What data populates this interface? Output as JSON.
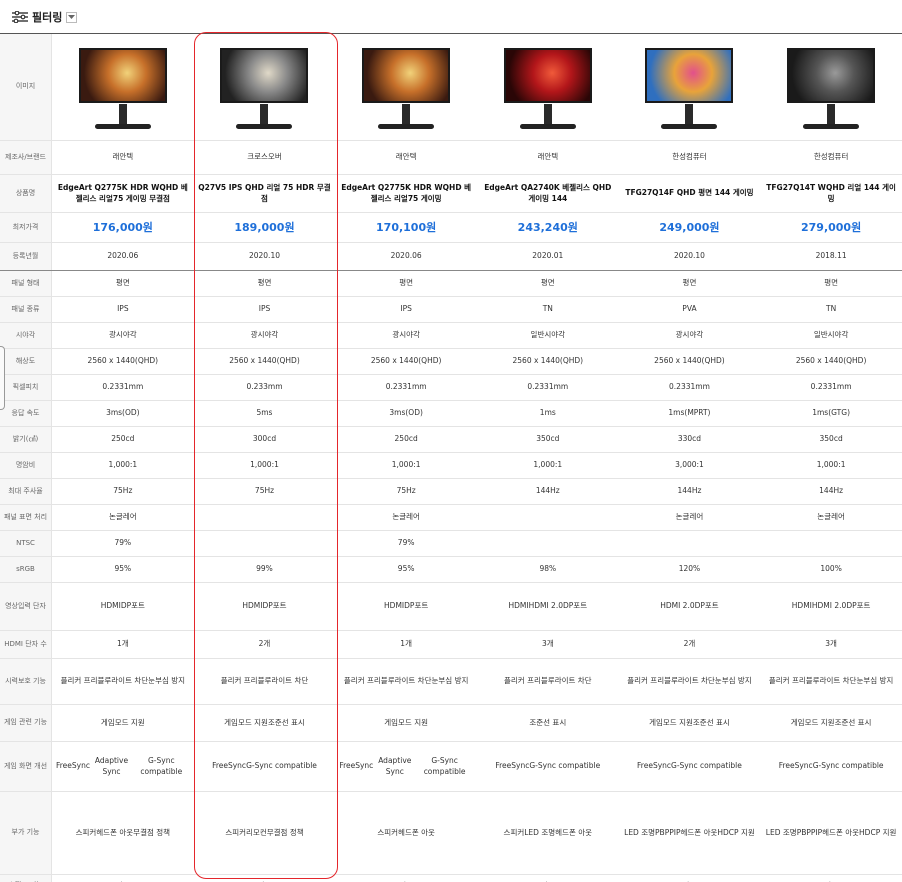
{
  "filter": {
    "label": "필터링"
  },
  "labels": {
    "image": "이미지",
    "maker": "제조사/브랜드",
    "name": "상품명",
    "price": "최저가격",
    "date": "등록년월",
    "panel_type": "패널 형태",
    "panel_kind": "패널 종류",
    "viewing_angle": "시야각",
    "resolution": "해상도",
    "pixel_pitch": "픽셀피치",
    "response": "응답 속도",
    "brightness": "밝기(㎠)",
    "contrast": "명암비",
    "refresh": "최대 주사율",
    "surface": "패널 표면 처리",
    "ntsc": "NTSC",
    "srgb": "sRGB",
    "inputs": "영상입력 단자",
    "hdmi_count": "HDMI 단자 수",
    "eye_care": "시력보호 기능",
    "gaming": "게임 관련 기능",
    "game_screen": "게임 화면 개선",
    "extra": "부가 기능",
    "stand": "스탠드 기능"
  },
  "products": [
    {
      "maker": "래안텍",
      "name": "EdgeArt Q2775K HDR WQHD 베젤리스 리얼75 게이밍 무결점",
      "price": "176,000원",
      "date": "2020.06",
      "panel_type": "평면",
      "panel_kind": "IPS",
      "viewing_angle": "광시야각",
      "resolution": "2560 x 1440(QHD)",
      "pixel_pitch": "0.2331mm",
      "response": "3ms(OD)",
      "brightness": "250cd",
      "contrast": "1,000:1",
      "refresh": "75Hz",
      "surface": "논글레어",
      "ntsc": "79%",
      "srgb": "95%",
      "inputs": [
        "HDMI",
        "DP포트"
      ],
      "hdmi_count": "1개",
      "eye_care": [
        "플리커 프리",
        "블루라이트 차단",
        "눈부심 방지"
      ],
      "gaming": [
        "게임모드 지원"
      ],
      "game_screen": [
        "FreeSync",
        "Adaptive Sync",
        "G-Sync compatible"
      ],
      "extra": [
        "스피커",
        "헤드폰 아웃",
        "무결점 정책"
      ],
      "stand": "틸트",
      "screen_colors": [
        "#3a1a10",
        "#c7702a",
        "#f1d27a"
      ]
    },
    {
      "maker": "크로스오버",
      "name": "Q27V5 IPS QHD 리얼 75 HDR 무결점",
      "price": "189,000원",
      "date": "2020.10",
      "panel_type": "평면",
      "panel_kind": "IPS",
      "viewing_angle": "광시야각",
      "resolution": "2560 x 1440(QHD)",
      "pixel_pitch": "0.233mm",
      "response": "5ms",
      "brightness": "300cd",
      "contrast": "1,000:1",
      "refresh": "75Hz",
      "surface": "",
      "ntsc": "",
      "srgb": "99%",
      "inputs": [
        "HDMI",
        "DP포트"
      ],
      "hdmi_count": "2개",
      "eye_care": [
        "플리커 프리",
        "블루라이트 차단"
      ],
      "gaming": [
        "게임모드 지원",
        "조준선 표시"
      ],
      "game_screen": [
        "FreeSync",
        "G-Sync compatible"
      ],
      "extra": [
        "스피커",
        "리모컨",
        "무결점 정책"
      ],
      "stand": "틸트",
      "screen_colors": [
        "#222222",
        "#8a8a8a",
        "#e0d9c8"
      ]
    },
    {
      "maker": "래안텍",
      "name": "EdgeArt Q2775K HDR WQHD 베젤리스 리얼75 게이밍",
      "price": "170,100원",
      "date": "2020.06",
      "panel_type": "평면",
      "panel_kind": "IPS",
      "viewing_angle": "광시야각",
      "resolution": "2560 x 1440(QHD)",
      "pixel_pitch": "0.2331mm",
      "response": "3ms(OD)",
      "brightness": "250cd",
      "contrast": "1,000:1",
      "refresh": "75Hz",
      "surface": "논글레어",
      "ntsc": "79%",
      "srgb": "95%",
      "inputs": [
        "HDMI",
        "DP포트"
      ],
      "hdmi_count": "1개",
      "eye_care": [
        "플리커 프리",
        "블루라이트 차단",
        "눈부심 방지"
      ],
      "gaming": [
        "게임모드 지원"
      ],
      "game_screen": [
        "FreeSync",
        "Adaptive Sync",
        "G-Sync compatible"
      ],
      "extra": [
        "스피커",
        "헤드폰 아웃"
      ],
      "stand": "틸트",
      "screen_colors": [
        "#3a1a10",
        "#c7702a",
        "#f1d27a"
      ]
    },
    {
      "maker": "래안텍",
      "name": "EdgeArt QA2740K 베젤리스 QHD 게이밍 144",
      "price": "243,240원",
      "date": "2020.01",
      "panel_type": "평면",
      "panel_kind": "TN",
      "viewing_angle": "일반시야각",
      "resolution": "2560 x 1440(QHD)",
      "pixel_pitch": "0.2331mm",
      "response": "1ms",
      "brightness": "350cd",
      "contrast": "1,000:1",
      "refresh": "144Hz",
      "surface": "",
      "ntsc": "",
      "srgb": "98%",
      "inputs": [
        "HDMI",
        "HDMI 2.0",
        "DP포트"
      ],
      "hdmi_count": "3개",
      "eye_care": [
        "플리커 프리",
        "블루라이트 차단"
      ],
      "gaming": [
        "조준선 표시"
      ],
      "game_screen": [
        "FreeSync",
        "G-Sync compatible"
      ],
      "extra": [
        "스피커",
        "LED 조명",
        "헤드폰 아웃"
      ],
      "stand": "틸트",
      "screen_colors": [
        "#2a0606",
        "#b3161a",
        "#f05a3a"
      ]
    },
    {
      "maker": "한성컴퓨터",
      "name": "TFG27Q14F QHD 평면 144 게이밍",
      "price": "249,000원",
      "date": "2020.10",
      "panel_type": "평면",
      "panel_kind": "PVA",
      "viewing_angle": "광시야각",
      "resolution": "2560 x 1440(QHD)",
      "pixel_pitch": "0.2331mm",
      "response": "1ms(MPRT)",
      "brightness": "330cd",
      "contrast": "3,000:1",
      "refresh": "144Hz",
      "surface": "논글레어",
      "ntsc": "",
      "srgb": "120%",
      "inputs": [
        "HDMI 2.0",
        "DP포트"
      ],
      "hdmi_count": "2개",
      "eye_care": [
        "플리커 프리",
        "블루라이트 차단",
        "눈부심 방지"
      ],
      "gaming": [
        "게임모드 지원",
        "조준선 표시"
      ],
      "game_screen": [
        "FreeSync",
        "G-Sync compatible"
      ],
      "extra": [
        "LED 조명",
        "PBP",
        "PIP",
        "헤드폰 아웃",
        "HDCP 지원"
      ],
      "stand": "틸트",
      "screen_colors": [
        "#2f6fbf",
        "#e8a33a",
        "#e2508c"
      ]
    },
    {
      "maker": "한성컴퓨터",
      "name": "TFG27Q14T WQHD 리얼 144 게이밍",
      "price": "279,000원",
      "date": "2018.11",
      "panel_type": "평면",
      "panel_kind": "TN",
      "viewing_angle": "일반시야각",
      "resolution": "2560 x 1440(QHD)",
      "pixel_pitch": "0.2331mm",
      "response": "1ms(GTG)",
      "brightness": "350cd",
      "contrast": "1,000:1",
      "refresh": "144Hz",
      "surface": "논글레어",
      "ntsc": "",
      "srgb": "100%",
      "inputs": [
        "HDMI",
        "HDMI 2.0",
        "DP포트"
      ],
      "hdmi_count": "3개",
      "eye_care": [
        "플리커 프리",
        "블루라이트 차단",
        "눈부심 방지"
      ],
      "gaming": [
        "게임모드 지원",
        "조준선 표시"
      ],
      "game_screen": [
        "FreeSync",
        "G-Sync compatible"
      ],
      "extra": [
        "LED 조명",
        "PBP",
        "PIP",
        "헤드폰 아웃",
        "HDCP 지원"
      ],
      "stand": "틸트",
      "screen_colors": [
        "#1a1a1a",
        "#555555",
        "#9a9a9a"
      ]
    }
  ]
}
